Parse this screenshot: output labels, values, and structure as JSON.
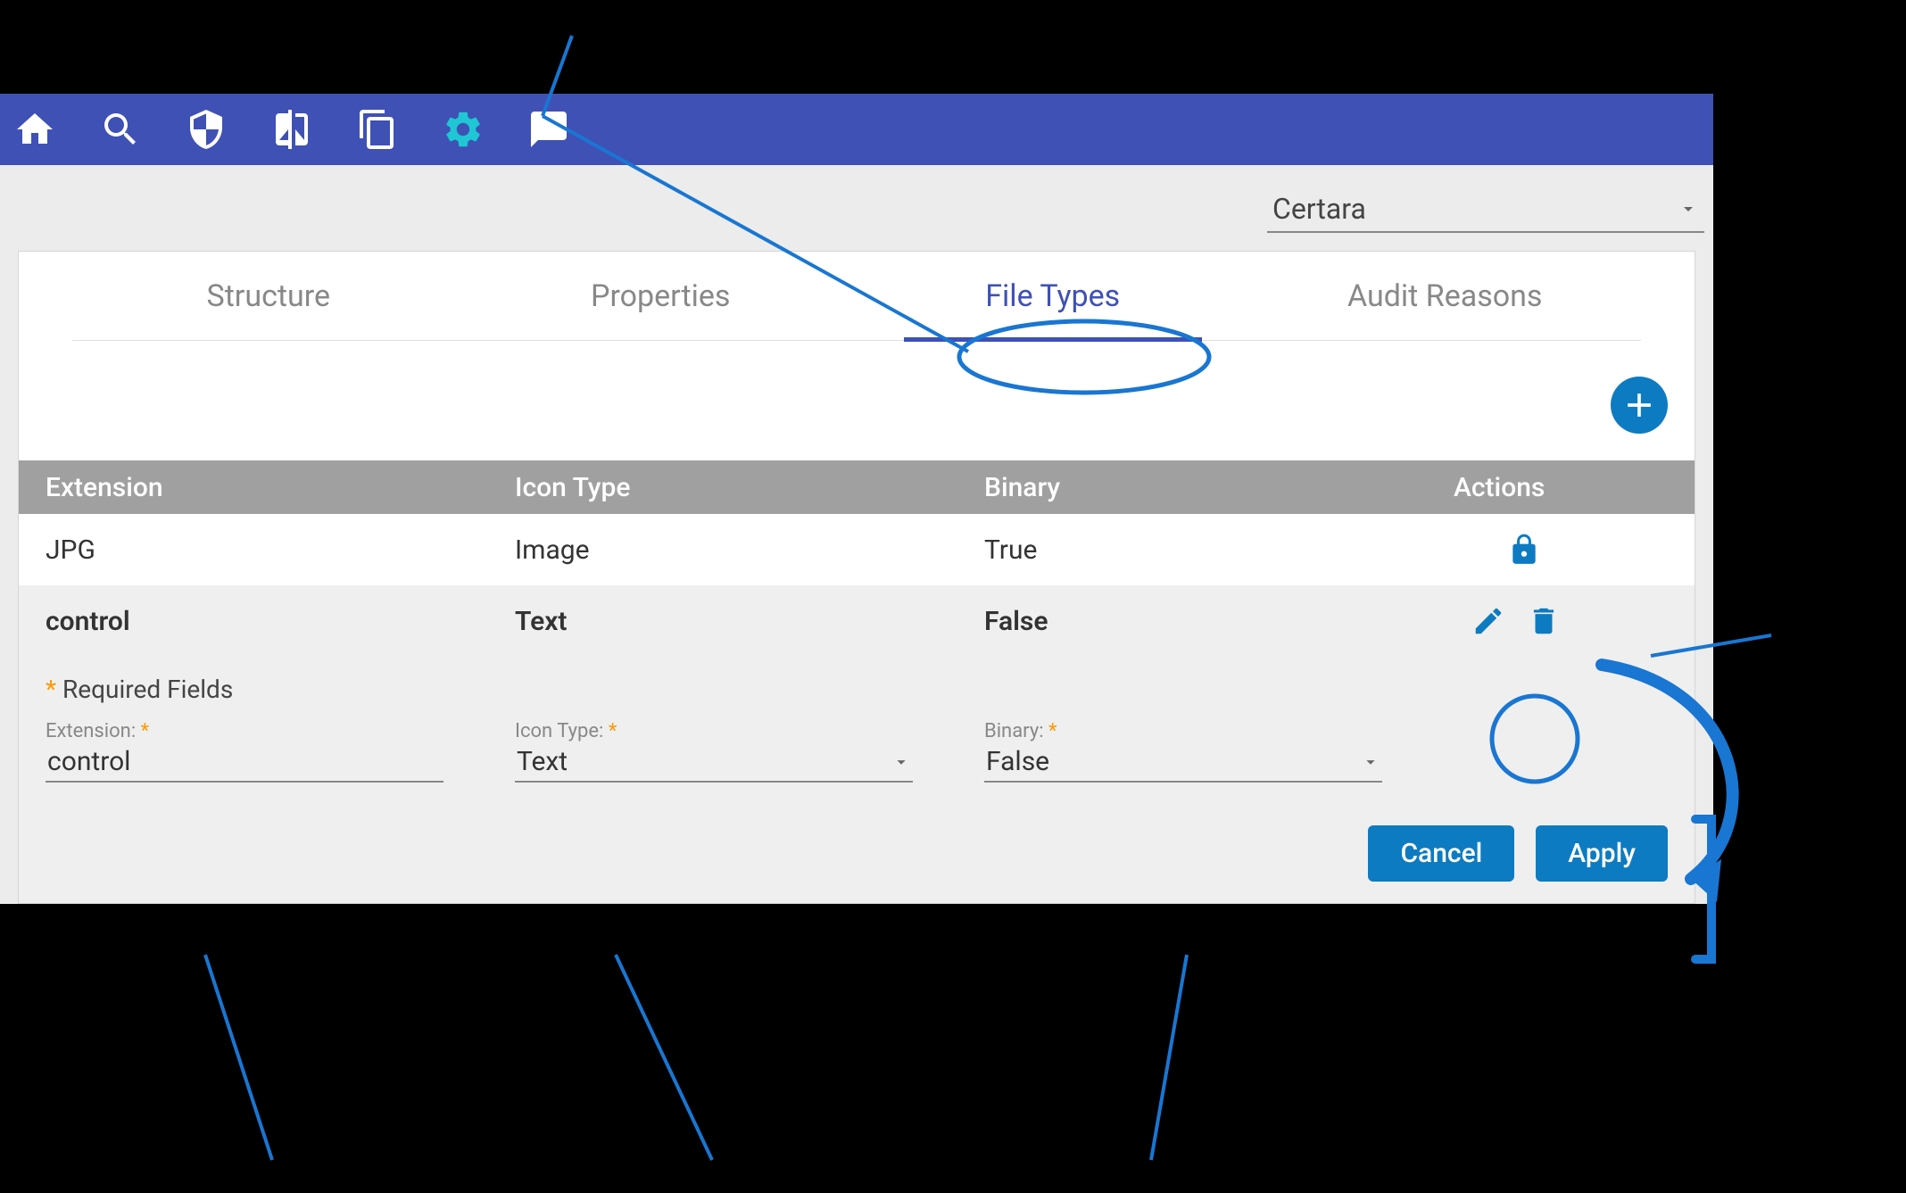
{
  "colors": {
    "primary": "#3f51b5",
    "accent_cyan": "#1fc7d4",
    "action_blue": "#0d7bc1"
  },
  "header": {
    "icons": [
      "home-icon",
      "search-icon",
      "shield-icon",
      "compare-icon",
      "copy-icon",
      "gear-icon",
      "feedback-icon"
    ]
  },
  "workspace": {
    "selected": "Certara"
  },
  "tabs": [
    {
      "label": "Structure",
      "active": false
    },
    {
      "label": "Properties",
      "active": false
    },
    {
      "label": "File Types",
      "active": true
    },
    {
      "label": "Audit Reasons",
      "active": false
    }
  ],
  "table": {
    "columns": [
      "Extension",
      "Icon Type",
      "Binary",
      "Actions"
    ],
    "rows": [
      {
        "extension": "JPG",
        "icon_type": "Image",
        "binary": "True",
        "locked": true,
        "editable": false
      },
      {
        "extension": "control",
        "icon_type": "Text",
        "binary": "False",
        "locked": false,
        "editable": true,
        "selected": true
      }
    ]
  },
  "form": {
    "required_label": "Required Fields",
    "extension_label": "Extension:",
    "extension_value": "control",
    "icon_type_label": "Icon Type:",
    "icon_type_value": "Text",
    "binary_label": "Binary:",
    "binary_value": "False",
    "cancel_label": "Cancel",
    "apply_label": "Apply"
  }
}
